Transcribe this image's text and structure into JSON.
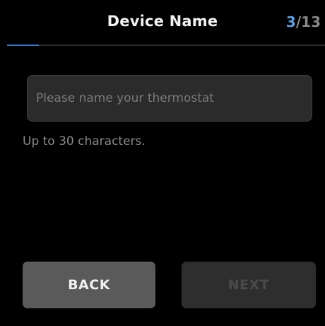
{
  "header": {
    "title": "Device Name",
    "step_current": "3",
    "step_total": "13",
    "progress_fraction": 0.1
  },
  "form": {
    "name_input": {
      "value": "",
      "placeholder": "Please name your thermostat"
    },
    "hint": "Up to 30 characters."
  },
  "buttons": {
    "back_label": "BACK",
    "next_label": "NEXT",
    "next_enabled": false
  },
  "colors": {
    "background": "#000000",
    "accent": "#2f7fd0",
    "step_current": "#5aa3e6",
    "back_button": "#5a5a5a",
    "next_button_disabled": "#2e2e2e"
  }
}
